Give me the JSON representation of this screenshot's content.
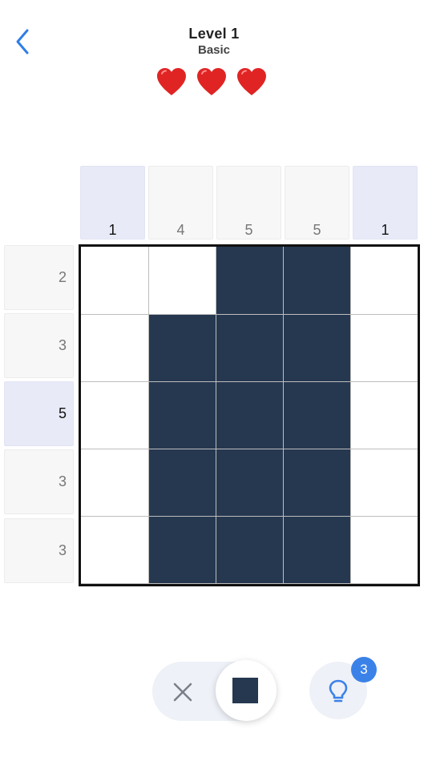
{
  "header": {
    "title": "Level 1",
    "subtitle": "Basic",
    "back_icon": "chevron-left-icon",
    "lives": 3,
    "heart_icon": "heart-icon",
    "heart_color": "#e02424"
  },
  "puzzle": {
    "column_clues": [
      {
        "value": "1",
        "highlighted": true
      },
      {
        "value": "4",
        "highlighted": false
      },
      {
        "value": "5",
        "highlighted": false
      },
      {
        "value": "5",
        "highlighted": false
      },
      {
        "value": "1",
        "highlighted": true
      }
    ],
    "row_clues": [
      {
        "value": "2",
        "highlighted": false
      },
      {
        "value": "3",
        "highlighted": false
      },
      {
        "value": "5",
        "highlighted": true
      },
      {
        "value": "3",
        "highlighted": false
      },
      {
        "value": "3",
        "highlighted": false
      }
    ],
    "cells": [
      [
        0,
        0,
        1,
        1,
        0
      ],
      [
        0,
        1,
        1,
        1,
        0
      ],
      [
        0,
        1,
        1,
        1,
        0
      ],
      [
        0,
        1,
        1,
        1,
        0
      ],
      [
        0,
        1,
        1,
        1,
        0
      ]
    ],
    "fill_color": "#263850",
    "highlight_color": "#e8eaf8"
  },
  "controls": {
    "cross_mode_icon": "x-icon",
    "fill_mode_icon": "filled-square-icon",
    "active_mode": "fill",
    "hint_icon": "lightbulb-icon",
    "hint_count": "3",
    "accent_color": "#3b82e8"
  }
}
